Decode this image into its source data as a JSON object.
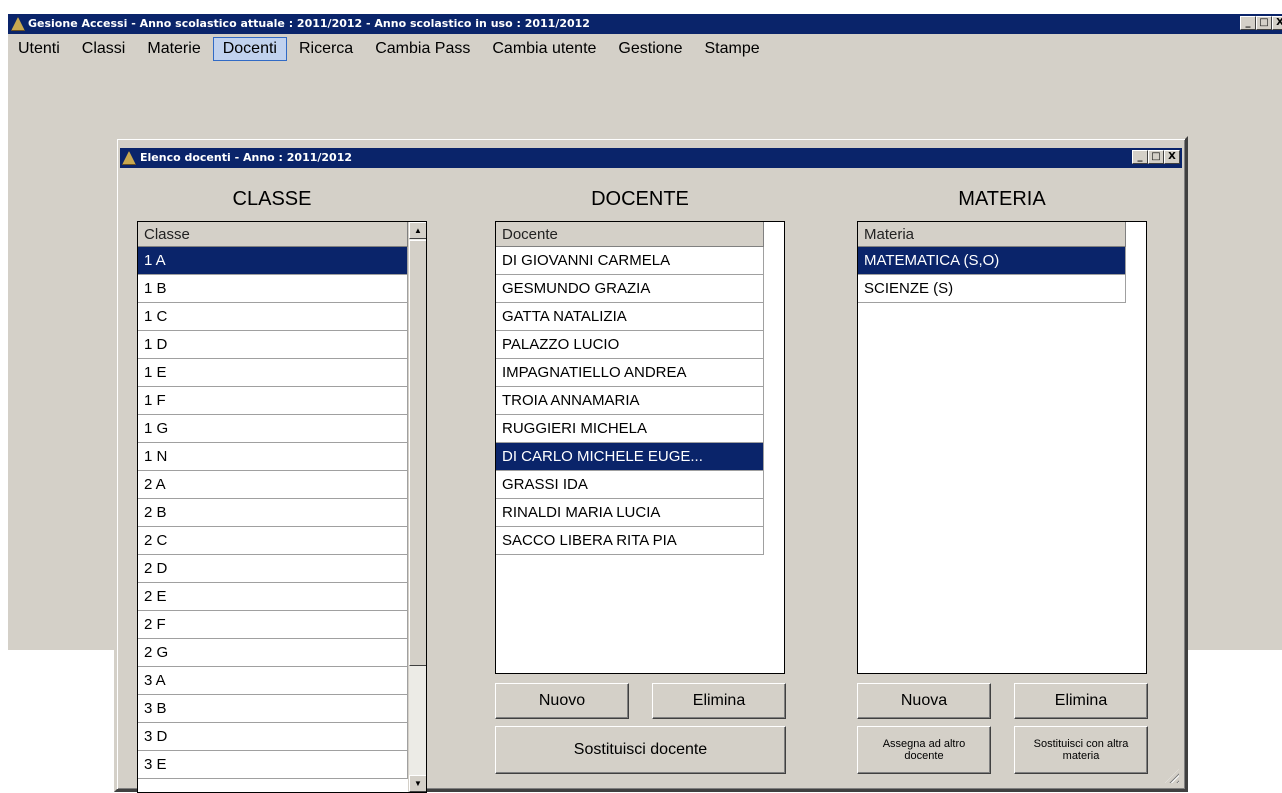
{
  "main_window": {
    "title": "Gesione Accessi - Anno scolastico attuale : 2011/2012 - Anno scolastico in uso : 2011/2012",
    "controls": [
      "_",
      "□",
      "X"
    ]
  },
  "menu": {
    "items": [
      "Utenti",
      "Classi",
      "Materie",
      "Docenti",
      "Ricerca",
      "Cambia Pass",
      "Cambia utente",
      "Gestione",
      "Stampe"
    ],
    "active": "Docenti"
  },
  "dialog": {
    "title": "Elenco docenti - Anno : 2011/2012",
    "controls": [
      "_",
      "□",
      "X"
    ]
  },
  "classe": {
    "heading": "CLASSE",
    "column": "Classe",
    "rows": [
      "1 A",
      "1 B",
      "1 C",
      "1 D",
      "1 E",
      "1 F",
      "1 G",
      "1 N",
      "2 A",
      "2 B",
      "2 C",
      "2 D",
      "2 E",
      "2 F",
      "2 G",
      "3 A",
      "3 B",
      "3 D",
      "3 E"
    ],
    "selected": 0,
    "scroll_up": "▲",
    "scroll_down": "▼"
  },
  "docente": {
    "heading": "DOCENTE",
    "column": "Docente",
    "rows": [
      "DI GIOVANNI CARMELA",
      "GESMUNDO GRAZIA",
      "GATTA NATALIZIA",
      "PALAZZO LUCIO",
      "IMPAGNATIELLO ANDREA",
      "TROIA ANNAMARIA",
      "RUGGIERI MICHELA",
      "DI CARLO MICHELE EUGE...",
      "GRASSI IDA",
      "RINALDI  MARIA LUCIA",
      "SACCO LIBERA RITA PIA"
    ],
    "selected": 7,
    "buttons": {
      "nuovo": "Nuovo",
      "elimina": "Elimina",
      "sostituisci": "Sostituisci docente"
    }
  },
  "materia": {
    "heading": "MATERIA",
    "column": "Materia",
    "rows": [
      "MATEMATICA (S,O)",
      "SCIENZE (S)"
    ],
    "selected": 0,
    "buttons": {
      "nuova": "Nuova",
      "elimina": "Elimina",
      "assegna": "Assegna ad altro docente",
      "sostituisci": "Sostituisci con altra materia"
    }
  }
}
